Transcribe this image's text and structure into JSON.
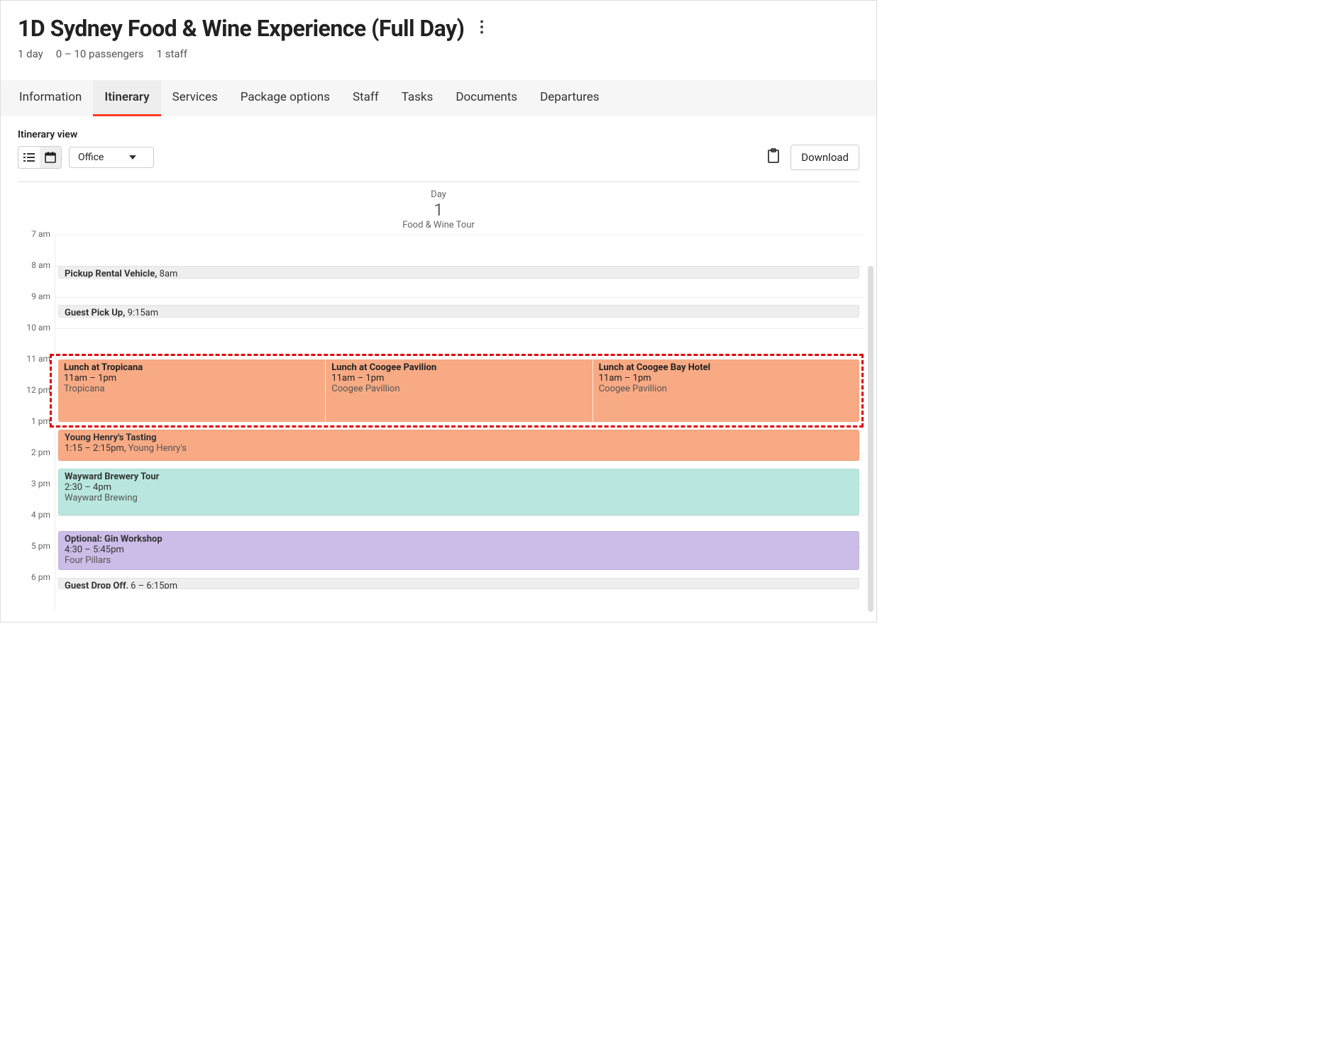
{
  "header": {
    "title": "1D Sydney Food & Wine Experience (Full Day)",
    "meta": {
      "duration": "1 day",
      "passengers": "0 – 10 passengers",
      "staff": "1 staff"
    }
  },
  "tabs": [
    "Information",
    "Itinerary",
    "Services",
    "Package options",
    "Staff",
    "Tasks",
    "Documents",
    "Departures"
  ],
  "active_tab": "Itinerary",
  "toolbar": {
    "label": "Itinerary view",
    "view_select": "Office",
    "download": "Download"
  },
  "day_header": {
    "label": "Day",
    "number": "1",
    "subtitle": "Food & Wine Tour"
  },
  "hours": [
    "7 am",
    "8 am",
    "9 am",
    "10 am",
    "11 am",
    "12 pm",
    "1 pm",
    "2 pm",
    "3 pm",
    "4 pm",
    "5 pm",
    "6 pm"
  ],
  "events": {
    "pickup_vehicle": {
      "title": "Pickup Rental Vehicle,",
      "time": "8am"
    },
    "guest_pickup": {
      "title": "Guest Pick Up,",
      "time": "9:15am"
    },
    "lunch": [
      {
        "title": "Lunch at Tropicana",
        "time": "11am – 1pm",
        "venue": "Tropicana"
      },
      {
        "title": "Lunch at Coogee Pavilion",
        "time": "11am – 1pm",
        "venue": "Coogee Pavillion"
      },
      {
        "title": "Lunch at Coogee Bay Hotel",
        "time": "11am – 1pm",
        "venue": "Coogee Pavillion"
      }
    ],
    "young_henrys": {
      "title": "Young Henry's Tasting",
      "time": "1:15 – 2:15pm,",
      "venue": "Young Henry's"
    },
    "wayward": {
      "title": "Wayward Brewery Tour",
      "time": "2:30 – 4pm",
      "venue": "Wayward Brewing"
    },
    "gin": {
      "title": "Optional: Gin Workshop",
      "time": "4:30 – 5:45pm",
      "venue": "Four Pillars"
    },
    "dropoff": {
      "title": "Guest Drop Off,",
      "time": "6 – 6:15pm"
    }
  },
  "colors": {
    "accent": "#ff3b1f",
    "event_orange": "#f7aa84",
    "event_teal": "#b9e7df",
    "event_purple": "#ccbce8",
    "highlight_dashed": "#e10000"
  }
}
